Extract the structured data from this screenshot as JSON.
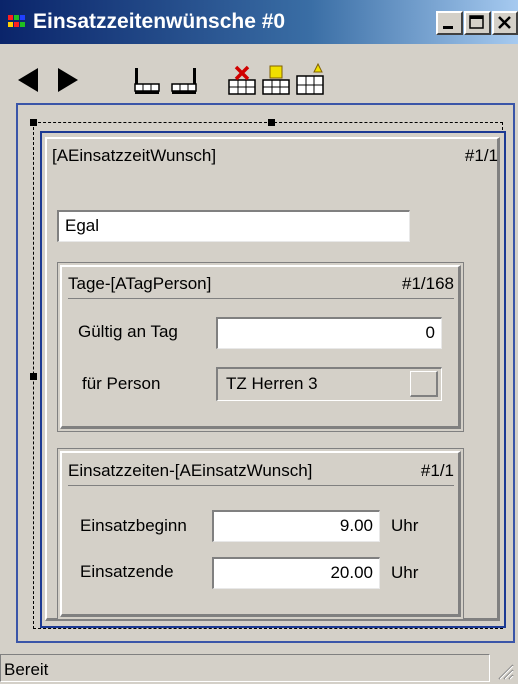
{
  "window": {
    "title": "Einsatzzeitenwünsche #0"
  },
  "toolbar": {
    "buttons": [
      "prev-record",
      "next-record",
      "insert-record",
      "append-record",
      "delete-record",
      "edit-record",
      "new-record"
    ]
  },
  "main_form": {
    "header_left": "[AEinsatzzeitWunsch]",
    "header_right": "#1/1",
    "description_value": "Egal"
  },
  "tage_panel": {
    "header_left": "Tage-[ATagPerson]",
    "header_right": "#1/168",
    "gueltig_label": "Gültig an Tag",
    "gueltig_value": "0",
    "person_label": "für Person",
    "person_value": "TZ Herren 3"
  },
  "einsatz_panel": {
    "header_left": "Einsatzzeiten-[AEinsatzWunsch]",
    "header_right": "#1/1",
    "beginn_label": "Einsatzbeginn",
    "beginn_value": "9.00",
    "beginn_unit": "Uhr",
    "ende_label": "Einsatzende",
    "ende_value": "20.00",
    "ende_unit": "Uhr"
  },
  "statusbar": {
    "text": "Bereit"
  },
  "colors": {
    "title_active": "#0a246a",
    "face": "#d4d0c8",
    "frame": "#1c3a94"
  }
}
